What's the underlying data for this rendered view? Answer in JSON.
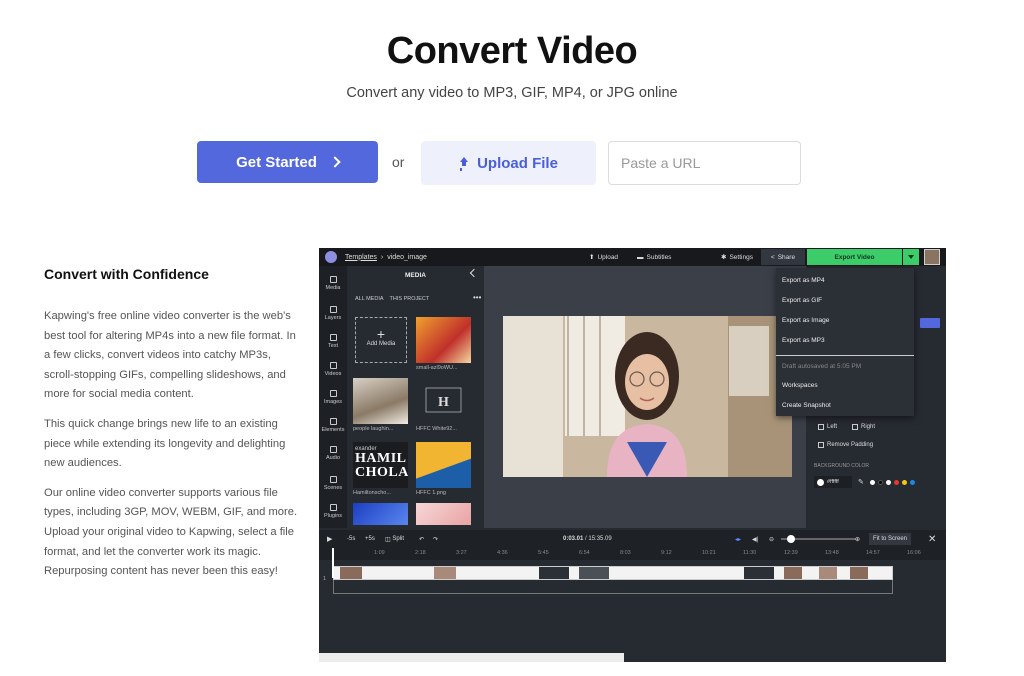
{
  "hero": {
    "title": "Convert Video",
    "subtitle": "Convert any video to MP3, GIF, MP4, or JPG online"
  },
  "cta": {
    "get_started_label": "Get Started",
    "or_text": "or",
    "upload_label": "Upload File",
    "url_placeholder": "Paste a URL"
  },
  "content": {
    "heading": "Convert with Confidence",
    "paragraphs": [
      "Kapwing's free online video converter is the web's best tool for altering MP4s into a new file format. In a few clicks, convert videos into catchy MP3s, scroll-stopping GIFs, compelling slideshows, and more for social media content.",
      "This quick change brings new life to an existing piece while extending its longevity and delighting new audiences.",
      "Our online video converter supports various file types, including 3GP, MOV, WEBM, GIF, and more. Upload your original video to Kapwing, select a file format, and let the converter work its magic. Repurposing content has never been this easy!"
    ]
  },
  "editor": {
    "breadcrumb_link": "Templates",
    "breadcrumb_sep": "›",
    "breadcrumb_current": "video_image",
    "top_upload": "Upload",
    "top_subtitles": "Subtitles",
    "top_settings": "Settings",
    "top_share": "Share",
    "top_export": "Export Video",
    "rail": [
      "Media",
      "Layers",
      "Text",
      "Videos",
      "Images",
      "Elements",
      "Audio",
      "Scenes",
      "Plugins"
    ],
    "media_title": "MEDIA",
    "media_tab_all": "ALL MEDIA",
    "media_tab_project": "THIS PROJECT",
    "add_media_plus": "+",
    "add_media": "Add Media",
    "thumbs": [
      "small-azl9oWU...",
      "people laughin...",
      "HFFC White92...",
      "Hamiltonscho...",
      "HFFC 1.png"
    ],
    "thumb_text_1": "HAMIL",
    "thumb_text_2": "CHOLAI",
    "thumb_text_3": "exander",
    "dropdown": {
      "items": [
        "Export as MP4",
        "Export as GIF",
        "Export as Image",
        "Export as MP3"
      ],
      "autosave": "Draft autosaved at 5:05 PM",
      "workspaces": "Workspaces",
      "snapshot": "Create Snapshot"
    },
    "right_panel": {
      "left": "Left",
      "right": "Right",
      "remove_padding": "Remove Padding",
      "bg_color_label": "BACKGROUND COLOR",
      "bg_hex": "#ffffff",
      "swatches": [
        "#ffffff",
        "#000000",
        "#ffffff",
        "#e53935",
        "#f5c518",
        "#1e88e5"
      ]
    },
    "toolbar": {
      "minus5": "-5s",
      "plus5": "+5s",
      "split": "Split",
      "time_current": "0:03.01",
      "time_total": "/ 15:35.09",
      "fit": "Fit to Screen"
    },
    "ruler": [
      "1:09",
      "2:18",
      "3:27",
      "4:36",
      "5:45",
      "6:54",
      "8:03",
      "9:12",
      "10:21",
      "11:30",
      "12:39",
      "13:48",
      "14:57",
      "16:06"
    ],
    "track_number": "1"
  }
}
